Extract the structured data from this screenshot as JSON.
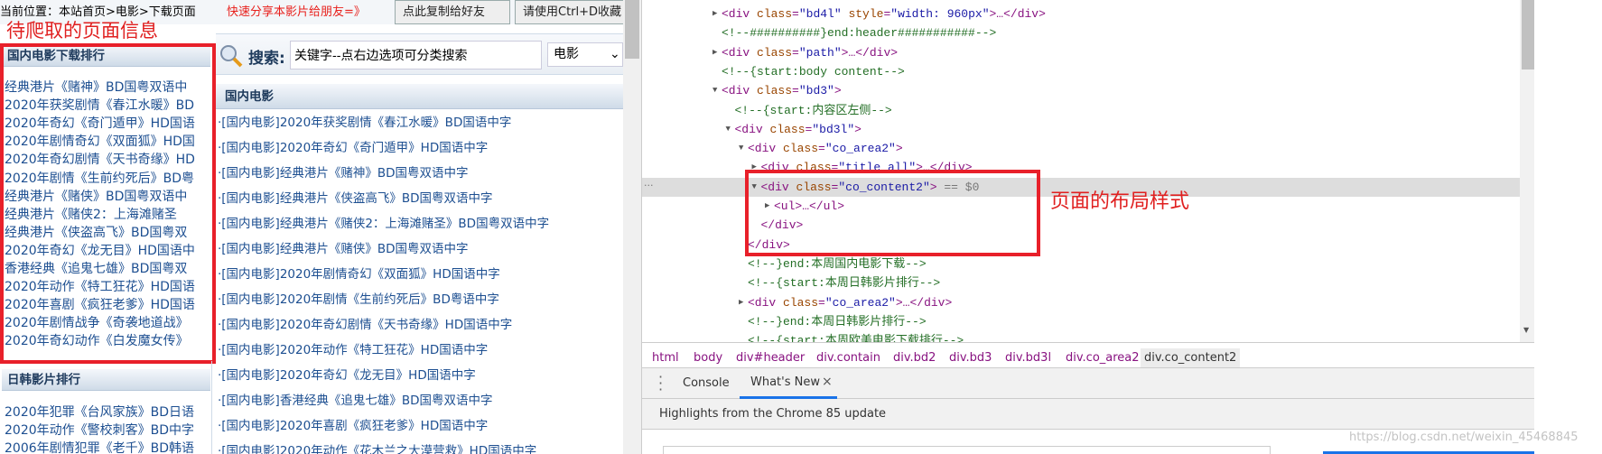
{
  "page": {
    "location": "当前位置：本站首页>电影>下载页面",
    "share_text": "快速分享本影片给朋友=》",
    "copy_button": "点此复制给好友",
    "bookmark_button": "请使用Ctrl+D收藏",
    "annotation_left": "待爬取的页面信息",
    "search": {
      "label": "搜索:",
      "value": "关键字--点右边选项可分类搜索",
      "category": "电影"
    },
    "sidebar_domestic": {
      "title": "国内电影下载排行",
      "items": [
        "经典港片《赌神》BD国粤双语中",
        "2020年获奖剧情《春江水暖》BD",
        "2020年奇幻《奇门遁甲》HD国语",
        "2020年剧情奇幻《双面狐》HD国",
        "2020年奇幻剧情《天书奇缘》HD",
        "2020年剧情《生前约死后》BD粤",
        "经典港片《赌侠》BD国粤双语中",
        "经典港片《赌侠2：上海滩赌圣",
        "经典港片《侠盗高飞》BD国粤双",
        "2020年奇幻《龙无目》HD国语中",
        "香港经典《追鬼七雄》BD国粤双",
        "2020年动作《特工狂花》HD国语",
        "2020年喜剧《疯狂老爹》HD国语",
        "2020年剧情战争《奇袭地道战》",
        "2020年奇幻动作《白发魔女传》"
      ]
    },
    "sidebar_jpkr": {
      "title": "日韩影片排行",
      "items": [
        "2020年犯罪《台风家族》BD日语",
        "2020年动作《警校刺客》BD中字",
        "2006年剧情犯罪《老千》BD韩语"
      ]
    },
    "main": {
      "title": "国内电影",
      "items": [
        "·[国内电影]2020年获奖剧情《春江水暖》BD国语中字",
        "·[国内电影]2020年奇幻《奇门遁甲》HD国语中字",
        "·[国内电影]经典港片《赌神》BD国粤双语中字",
        "·[国内电影]经典港片《侠盗高飞》BD国粤双语中字",
        "·[国内电影]经典港片《赌侠2：上海滩赌圣》BD国粤双语中字",
        "·[国内电影]经典港片《赌侠》BD国粤双语中字",
        "·[国内电影]2020年剧情奇幻《双面狐》HD国语中字",
        "·[国内电影]2020年剧情《生前约死后》BD粤语中字",
        "·[国内电影]2020年奇幻剧情《天书奇缘》HD国语中字",
        "·[国内电影]2020年动作《特工狂花》HD国语中字",
        "·[国内电影]2020年奇幻《龙无目》HD国语中字",
        "·[国内电影]香港经典《追鬼七雄》BD国粤双语中字",
        "·[国内电影]2020年喜剧《疯狂老爹》HD国语中字",
        "·[国内电影]2020年动作《花木兰之大漠营救》HD国语中字"
      ]
    }
  },
  "devtools": {
    "ellipsis": "...",
    "annotation": "页面的布局样式",
    "selected_marker": " == $0",
    "lines": [
      {
        "depth": 0,
        "arrow": "right",
        "code": "<div class=\"bd4l\" style=\"width: 960px\">…</div>"
      },
      {
        "depth": 0,
        "arrow": "",
        "code": "<!--##########}end:header###########-->"
      },
      {
        "depth": 0,
        "arrow": "right",
        "code": "<div class=\"path\">…</div>"
      },
      {
        "depth": 0,
        "arrow": "",
        "code": "<!--{start:body content-->"
      },
      {
        "depth": 0,
        "arrow": "down",
        "code": "<div class=\"bd3\">"
      },
      {
        "depth": 1,
        "arrow": "",
        "code": "<!--{start:内容区左侧-->"
      },
      {
        "depth": 1,
        "arrow": "down",
        "code": "<div class=\"bd3l\">"
      },
      {
        "depth": 2,
        "arrow": "down",
        "code": "<div class=\"co_area2\">"
      },
      {
        "depth": 3,
        "arrow": "right",
        "code": "<div class=\"title_all\">…</div>"
      },
      {
        "depth": 3,
        "arrow": "down",
        "code": "<div class=\"co_content2\">",
        "selected": true
      },
      {
        "depth": 4,
        "arrow": "right",
        "code": "<ul>…</ul>"
      },
      {
        "depth": 3,
        "arrow": "",
        "code": "</div>"
      },
      {
        "depth": 2,
        "arrow": "",
        "code": "</div>"
      },
      {
        "depth": 2,
        "arrow": "",
        "code": "<!--}end:本周国内电影下载-->"
      },
      {
        "depth": 2,
        "arrow": "",
        "code": "<!--{start:本周日韩影片排行-->"
      },
      {
        "depth": 2,
        "arrow": "right",
        "code": "<div class=\"co_area2\">…</div>"
      },
      {
        "depth": 2,
        "arrow": "",
        "code": "<!--}end:本周日韩影片排行-->"
      },
      {
        "depth": 2,
        "arrow": "",
        "code": "<!--{start:本周欧美电影下载排行-->"
      }
    ],
    "breadcrumbs": [
      "html",
      "body",
      "div#header",
      "div.contain",
      "div.bd2",
      "div.bd3",
      "div.bd3l",
      "div.co_area2",
      "div.co_content2"
    ],
    "drawer_tabs": [
      "Console",
      "What's New"
    ],
    "whats_new_close": "×",
    "highlights": "Highlights from the Chrome 85 update",
    "watermark": "https://blog.csdn.net/weixin_45468845"
  },
  "colors": {
    "tag": "#881280",
    "attr_name": "#994500",
    "attr_value": "#1a1aa6",
    "comment": "#236e25",
    "link": "#1d4f91",
    "annotation": "#e02020",
    "tab_active": "#1a73e8"
  }
}
